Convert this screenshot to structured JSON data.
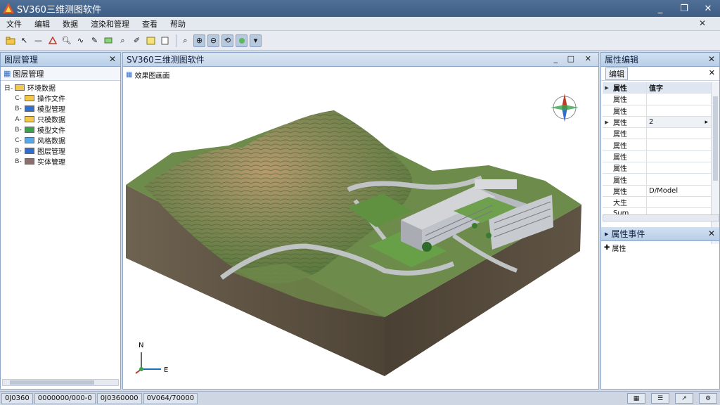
{
  "window": {
    "title": "SV360三维测图软件",
    "buttons": [
      "_",
      "❐",
      "✕"
    ]
  },
  "menu": {
    "items": [
      "文件",
      "编辑",
      "数据",
      "渲染和管理",
      "查看",
      "帮助"
    ],
    "close": "✕"
  },
  "toolbar": {
    "icons": [
      "folder-icon",
      "cursor-icon",
      "line-icon",
      "polygon-icon",
      "zoom-icon",
      "node-icon",
      "pen-icon",
      "layer-icon",
      "search-icon",
      "edit-icon",
      "save-icon",
      "doc-icon",
      "magnifier-icon",
      "zoom-in-icon",
      "zoom-out-icon",
      "rotate-icon",
      "refresh-icon",
      "dropdown-icon"
    ]
  },
  "left_panel": {
    "title": "图层管理",
    "close": "✕",
    "root_label": "图层管理",
    "tree": [
      {
        "prefix": "日-",
        "label": "环境数据",
        "color": "#f2c94c"
      },
      {
        "prefix": "C-",
        "label": "操作文件",
        "color": "#f2c94c"
      },
      {
        "prefix": "B-",
        "label": "模型管理",
        "color": "#2f6fd1"
      },
      {
        "prefix": "A-",
        "label": "只模数据",
        "color": "#f2c94c"
      },
      {
        "prefix": "B-",
        "label": "模型文件",
        "color": "#3aa34a"
      },
      {
        "prefix": "C-",
        "label": "风格数据",
        "color": "#5aa7e8"
      },
      {
        "prefix": "B-",
        "label": "图层管理",
        "color": "#2f6fd1"
      },
      {
        "prefix": "B-",
        "label": "实体管理",
        "color": "#8a6e6e"
      }
    ]
  },
  "view": {
    "title": "SV360三维测图软件",
    "subtitle": "效果图画面",
    "controls": [
      "_",
      "□",
      "✕"
    ],
    "axis_n": "N",
    "axis_e": "E"
  },
  "right_panel": {
    "title": "属性编辑",
    "close": "✕",
    "tab": "编辑",
    "tab_close": "✕",
    "header": {
      "name": "属性",
      "value": "值字"
    },
    "rows": [
      {
        "name": "属性",
        "value": ""
      },
      {
        "name": "属性",
        "value": ""
      },
      {
        "name": "属性",
        "value": "2",
        "dropdown": true
      },
      {
        "name": "属性",
        "value": ""
      },
      {
        "name": "属性",
        "value": ""
      },
      {
        "name": "属性",
        "value": ""
      },
      {
        "name": "属性",
        "value": ""
      },
      {
        "name": "属性",
        "value": ""
      },
      {
        "name": "属性",
        "value": "D/Model"
      },
      {
        "name": "大生",
        "value": ""
      },
      {
        "name": "Sum",
        "value": ""
      }
    ],
    "event_title": "属性事件",
    "event_close": "✕",
    "event_item": "属性"
  },
  "statusbar": {
    "seg1": "0J0360",
    "seg2": "0000000/000-0",
    "seg3": "0J0360000",
    "seg4": "0V064/70000",
    "right_icons": [
      "grid-icon",
      "list-icon",
      "arrow-icon",
      "settings-icon"
    ]
  },
  "colors": {
    "titlebar": "#4a6a92",
    "terrain_green": "#6b8a4c",
    "terrain_side": "#5a4c3c",
    "grass": "#6a9b4e",
    "building": "#b9bcc2"
  }
}
